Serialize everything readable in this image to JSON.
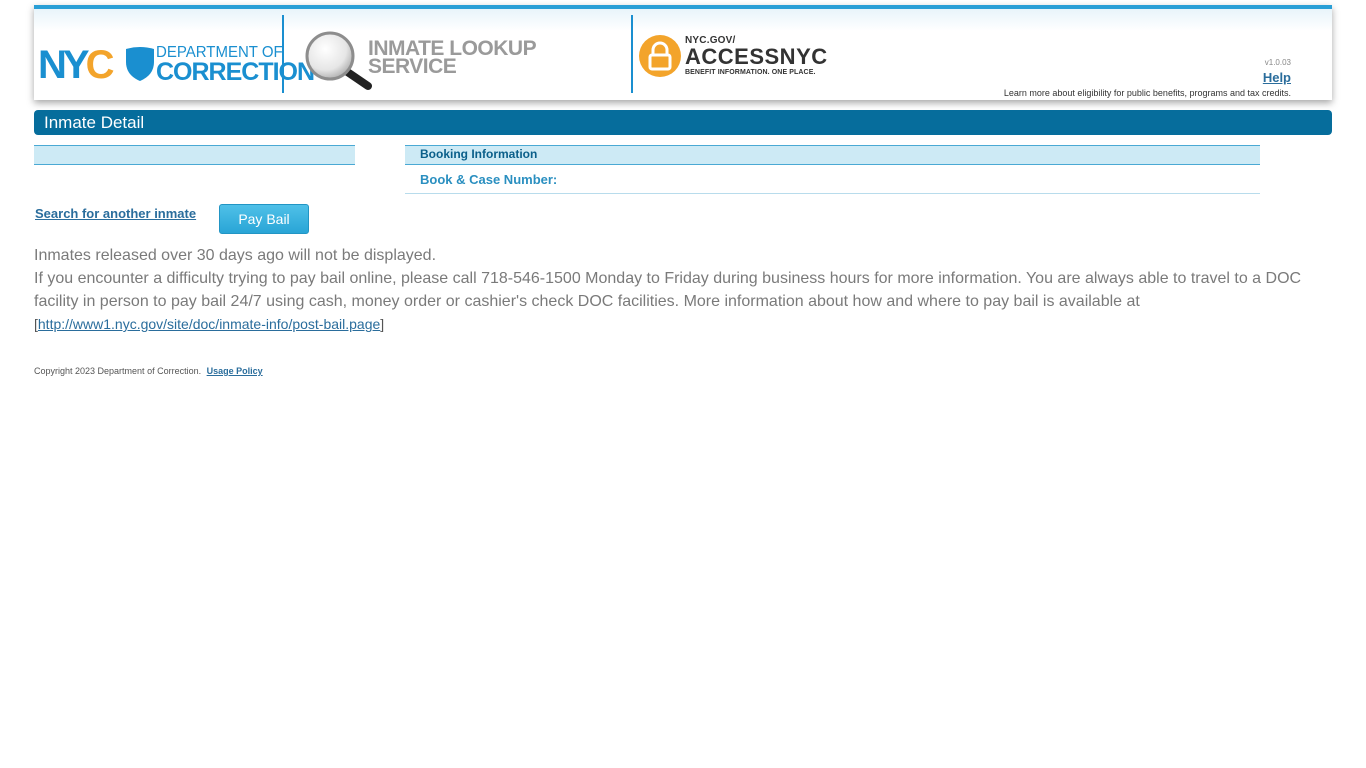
{
  "header": {
    "nyc_logo": {
      "n": "N",
      "y": "Y",
      "c": "C"
    },
    "dept_line1": "DEPARTMENT OF",
    "dept_line2": "CORRECTION",
    "service_line1": "INMATE LOOKUP",
    "service_line2": "SERVICE",
    "access_line1": "NYC.GOV/",
    "access_line2": "ACCESSNYC",
    "access_line3": "BENEFIT INFORMATION. ONE PLACE.",
    "version": "v1.0.03",
    "help_label": "Help",
    "learn_more": "Learn more about eligibility for public benefits, programs and tax credits."
  },
  "titlebar": {
    "title": "Inmate Detail"
  },
  "booking": {
    "heading": "Booking Information",
    "book_case_label": "Book & Case Number:"
  },
  "actions": {
    "search_link": "Search for another inmate",
    "pay_bail": "Pay Bail"
  },
  "info": {
    "line1": "Inmates released over 30 days ago will not be displayed.",
    "line2": "If you encounter a difficulty trying to pay bail online, please call 718-546-1500 Monday to Friday during business hours for more information. You are always able to travel to a DOC facility in person to pay bail 24/7 using cash, money order or cashier's check DOC facilities. More information about how and where to pay bail is available at",
    "link_open": "[",
    "link_text": "http://www1.nyc.gov/site/doc/inmate-info/post-bail.page",
    "link_close": "]"
  },
  "footer": {
    "copyright": "Copyright 2023 Department of Correction.",
    "usage_policy": "Usage Policy"
  },
  "colors": {
    "brand_blue": "#1a8fd0",
    "title_bar": "#066d9c",
    "panel_bg": "#cdeaf5",
    "accent_orange": "#f3a42b",
    "button": "#29a5d6"
  }
}
